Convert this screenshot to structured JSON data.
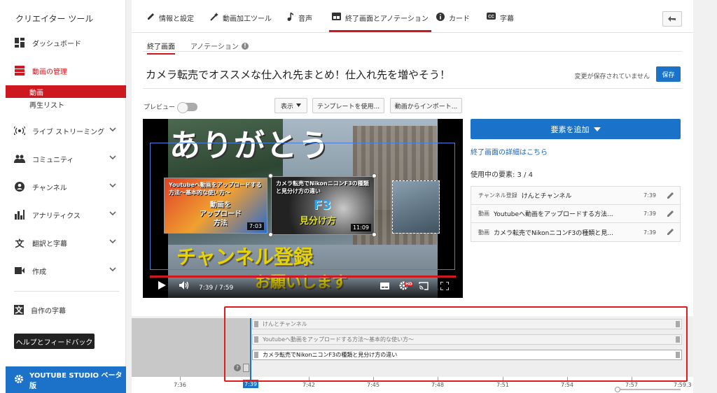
{
  "sidebar": {
    "title": "クリエイター ツール",
    "items": [
      {
        "label": "ダッシュボード",
        "icon": "dashboard-icon"
      },
      {
        "label": "動画の管理",
        "icon": "video-manager-icon"
      },
      {
        "label": "ライブ ストリーミング",
        "icon": "live-icon"
      },
      {
        "label": "コミュニティ",
        "icon": "community-icon"
      },
      {
        "label": "チャンネル",
        "icon": "channel-icon"
      },
      {
        "label": "アナリティクス",
        "icon": "analytics-icon"
      },
      {
        "label": "翻訳と字幕",
        "icon": "translate-icon"
      },
      {
        "label": "作成",
        "icon": "create-icon"
      },
      {
        "label": "自作の字幕",
        "icon": "own-subtitles-icon"
      }
    ],
    "subitems": [
      "動画",
      "再生リスト"
    ],
    "help_label": "ヘルプとフィードバック",
    "studio_label": "YOUTUBE STUDIO ベータ版",
    "accent": "#cc181e"
  },
  "tabs": [
    {
      "label": "情報と設定",
      "icon": "pencil-icon"
    },
    {
      "label": "動画加工ツール",
      "icon": "wand-icon"
    },
    {
      "label": "音声",
      "icon": "music-note-icon"
    },
    {
      "label": "終了画面とアノテーション",
      "icon": "end-screen-icon"
    },
    {
      "label": "カード",
      "icon": "info-icon"
    },
    {
      "label": "字幕",
      "icon": "cc-icon"
    }
  ],
  "subtabs": [
    "終了画面",
    "アノテーション"
  ],
  "video_title": "カメラ転売でオススメな仕入れ先まとめ！仕入れ先を増やそう！",
  "unsaved_text": "変更が保存されていません",
  "save_label": "保存",
  "toolbar": {
    "preview_label": "プレビュー",
    "view_label": "表示",
    "template_label": "テンプレートを使用...",
    "import_label": "動画からインポート..."
  },
  "video": {
    "overlay_thanks": "ありがとう",
    "card1_title": "Youtubeへ動画をアップロードする方法〜基本的な使い方〜",
    "card1_art": "動画を\nアップロード\n方法",
    "card1_dur": "7:03",
    "card2_title": "カメラ転売でNikonニコンF3の種類と見分け方の違い",
    "card2_art_top": "F3",
    "card2_art_bottom": "見分け方",
    "card2_dur": "11:09",
    "subscribe_text": "チャンネル登録",
    "please_text": "お願いします",
    "time": "7:39 / 7:59",
    "progress": 0.98
  },
  "right": {
    "add_label": "要素を追加",
    "details_link": "終了画面の詳細はこちら",
    "in_use": "使用中の要素: 3 / 4",
    "elements": [
      {
        "type": "チャンネル登録",
        "name": "けんとチャンネル",
        "time": "7:39"
      },
      {
        "type": "動画",
        "name": "Youtubeへ動画をアップロードする方法...",
        "time": "7:39"
      },
      {
        "type": "動画",
        "name": "カメラ転売でNikonニコンF3の種類と見...",
        "time": "7:39"
      }
    ]
  },
  "timeline": {
    "tracks": [
      "けんとチャンネル",
      "Youtubeへ動画をアップロードする方法〜基本的な使い方〜",
      "カメラ転売でNikonニコンF3の種類と見分け方の違い"
    ],
    "cursor": "7:39",
    "ticks": [
      "7:36",
      "7:39",
      "7:42",
      "7:45",
      "7:48",
      "7:51",
      "7:54",
      "7:57",
      "7:59.3"
    ]
  }
}
